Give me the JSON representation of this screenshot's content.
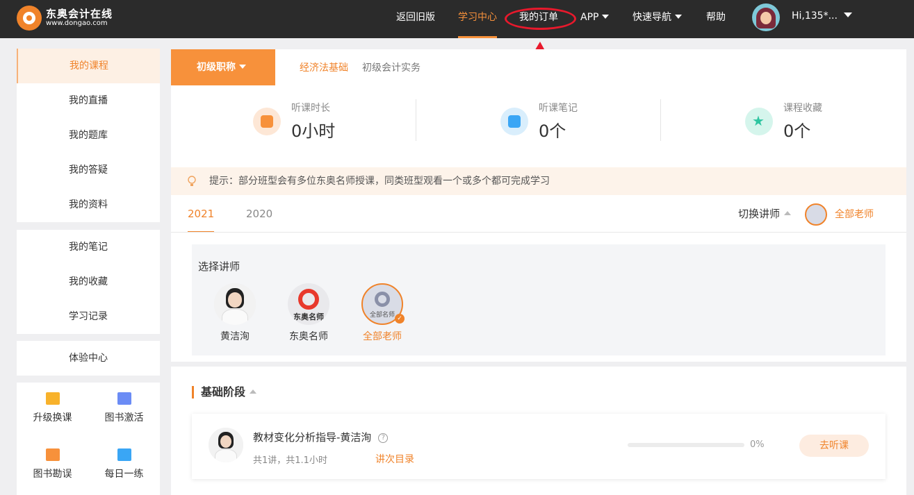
{
  "header": {
    "logo_name": "东奥会计在线",
    "logo_url": "www.dongao.com",
    "nav": {
      "old_version": "返回旧版",
      "study_center": "学习中心",
      "my_orders": "我的订单",
      "app": "APP",
      "quick_nav": "快速导航",
      "help": "帮助"
    },
    "user_greeting": "Hi,135*..."
  },
  "sidebar": {
    "group1": [
      "我的课程",
      "我的直播",
      "我的题库",
      "我的答疑",
      "我的资料"
    ],
    "group2": [
      "我的笔记",
      "我的收藏",
      "学习记录"
    ],
    "group3": [
      "体验中心"
    ],
    "tools": [
      {
        "label": "升级换课",
        "icon": "upgrade-icon"
      },
      {
        "label": "图书激活",
        "icon": "card-icon"
      },
      {
        "label": "图书勘误",
        "icon": "book-icon"
      },
      {
        "label": "每日一练",
        "icon": "practice-icon"
      }
    ]
  },
  "subject_bar": {
    "active": "初级职称",
    "links": [
      "经济法基础",
      "初级会计实务"
    ]
  },
  "stats": [
    {
      "label": "听课时长",
      "value": "0小时",
      "icon": "clock-icon",
      "color": "#f7913b"
    },
    {
      "label": "听课笔记",
      "value": "0个",
      "icon": "note-icon",
      "color": "#3aa6f5"
    },
    {
      "label": "课程收藏",
      "value": "0个",
      "icon": "star-icon",
      "color": "#2ec5a0"
    }
  ],
  "tip": "提示：部分班型会有多位东奥名师授课，同类班型观看一个或多个都可完成学习",
  "years": [
    "2021",
    "2020"
  ],
  "teacher_switch": {
    "label": "切换讲师",
    "current": "全部老师"
  },
  "teacher_select": {
    "title": "选择讲师",
    "teachers": [
      {
        "name": "黄洁洵"
      },
      {
        "name": "东奥名师",
        "badge": "东奥名师"
      },
      {
        "name": "全部老师",
        "badge": "全部名师",
        "selected": true
      }
    ]
  },
  "stage": {
    "title": "基础阶段",
    "course": {
      "title": "教材变化分析指导-黄洁洵",
      "meta": "共1讲，共1.1小时",
      "toc": "讲次目录",
      "progress": 0,
      "progress_text": "0%",
      "button": "去听课"
    }
  },
  "colors": {
    "accent": "#f0832a",
    "topbar": "#2b2b2b",
    "annotation_red": "#e8192c"
  }
}
